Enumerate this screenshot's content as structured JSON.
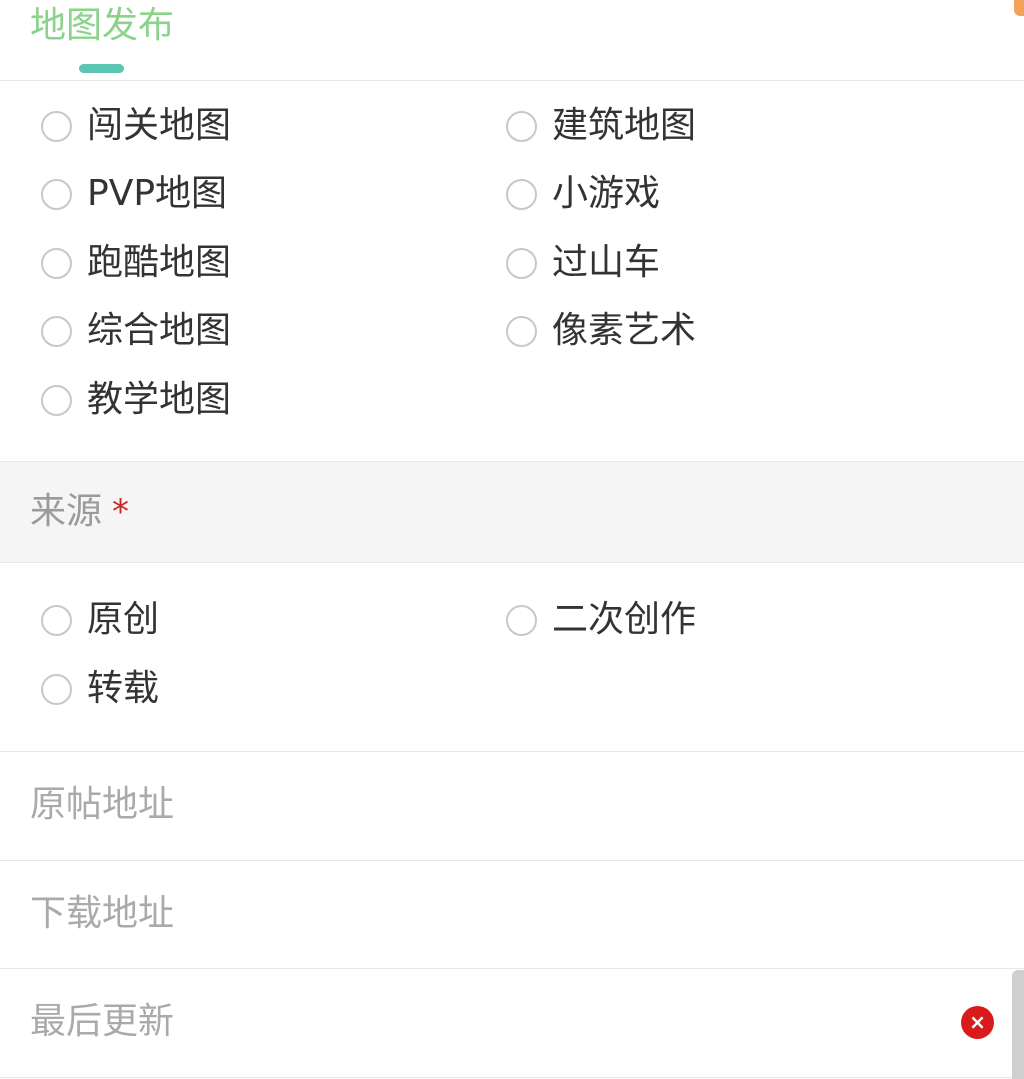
{
  "header": {
    "tab_label": "地图发布"
  },
  "map_type": {
    "options": [
      "闯关地图",
      "建筑地图",
      "PVP地图",
      "小游戏",
      "跑酷地图",
      "过山车",
      "综合地图",
      "像素艺术",
      "教学地图"
    ]
  },
  "source": {
    "title": "来源",
    "required_mark": "*",
    "options": [
      "原创",
      "二次创作",
      "转载"
    ]
  },
  "fields": {
    "original_url_placeholder": "原帖地址",
    "download_url_placeholder": "下载地址",
    "last_update_placeholder": "最后更新",
    "clear_icon": "×"
  },
  "colors": {
    "tab_text": "#8bd28b",
    "tab_indicator": "#5cc6b4",
    "required": "#c62828",
    "clear_button": "#d91a1a"
  }
}
